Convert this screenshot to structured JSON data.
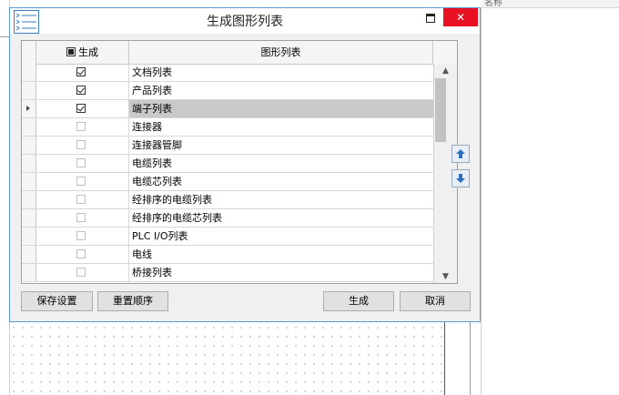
{
  "background": {
    "right_panel_header": "名称"
  },
  "dialog": {
    "title": "生成图形列表",
    "close_glyph": "✕"
  },
  "grid": {
    "columns": {
      "generate": "生成",
      "name": "图形列表"
    },
    "rows": [
      {
        "name": "文档列表",
        "checked": true
      },
      {
        "name": "产品列表",
        "checked": true
      },
      {
        "name": "端子列表",
        "checked": true,
        "selected": true
      },
      {
        "name": "连接器",
        "checked": false
      },
      {
        "name": "连接器管脚",
        "checked": false
      },
      {
        "name": "电缆列表",
        "checked": false
      },
      {
        "name": "电缆芯列表",
        "checked": false
      },
      {
        "name": "经排序的电缆列表",
        "checked": false
      },
      {
        "name": "经排序的电缆芯列表",
        "checked": false
      },
      {
        "name": "PLC I/O列表",
        "checked": false
      },
      {
        "name": "电线",
        "checked": false
      },
      {
        "name": "桥接列表",
        "checked": false
      }
    ]
  },
  "buttons": {
    "save_settings": "保存设置",
    "reset_order": "重置顺序",
    "generate": "生成",
    "cancel": "取消"
  },
  "colors": {
    "close": "#e81123",
    "selection": "#c9c9c9",
    "dialog_border": "#5a9bd5"
  }
}
